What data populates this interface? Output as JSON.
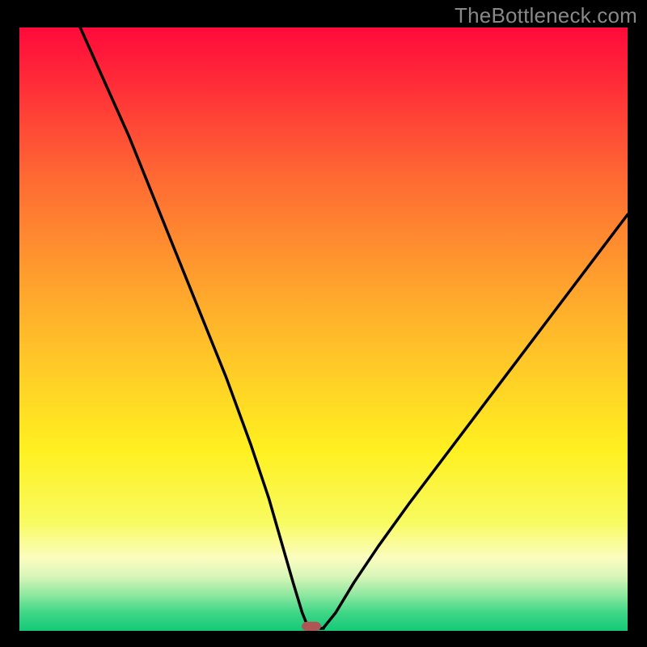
{
  "watermark": "TheBottleneck.com",
  "chart_data": {
    "type": "line",
    "title": "",
    "xlabel": "",
    "ylabel": "",
    "xlim": [
      0,
      100
    ],
    "ylim": [
      0,
      100
    ],
    "notch": {
      "x": 48,
      "width": 3.2,
      "height": 1.5
    },
    "curve_left": [
      {
        "x": 10,
        "y": 100
      },
      {
        "x": 14,
        "y": 91
      },
      {
        "x": 18,
        "y": 82
      },
      {
        "x": 22,
        "y": 72
      },
      {
        "x": 26,
        "y": 62
      },
      {
        "x": 30,
        "y": 52
      },
      {
        "x": 34,
        "y": 42
      },
      {
        "x": 38,
        "y": 31
      },
      {
        "x": 41,
        "y": 22
      },
      {
        "x": 43,
        "y": 15
      },
      {
        "x": 45,
        "y": 8
      },
      {
        "x": 46.5,
        "y": 3
      },
      {
        "x": 47.5,
        "y": 0.5
      }
    ],
    "curve_right": [
      {
        "x": 50,
        "y": 0.5
      },
      {
        "x": 52,
        "y": 3
      },
      {
        "x": 55,
        "y": 8
      },
      {
        "x": 59,
        "y": 14
      },
      {
        "x": 64,
        "y": 21
      },
      {
        "x": 70,
        "y": 29
      },
      {
        "x": 76,
        "y": 37
      },
      {
        "x": 82,
        "y": 45
      },
      {
        "x": 88,
        "y": 53
      },
      {
        "x": 94,
        "y": 61
      },
      {
        "x": 100,
        "y": 69
      }
    ],
    "gradient_stops": [
      {
        "offset": 0,
        "color": "#ff0a3a"
      },
      {
        "offset": 10,
        "color": "#ff2f38"
      },
      {
        "offset": 25,
        "color": "#ff6a33"
      },
      {
        "offset": 40,
        "color": "#ff9a2e"
      },
      {
        "offset": 55,
        "color": "#ffc728"
      },
      {
        "offset": 70,
        "color": "#fff020"
      },
      {
        "offset": 82,
        "color": "#f8fb60"
      },
      {
        "offset": 88,
        "color": "#fbfdc0"
      },
      {
        "offset": 91,
        "color": "#d8f5b8"
      },
      {
        "offset": 94,
        "color": "#8fe8a0"
      },
      {
        "offset": 97,
        "color": "#3fd687"
      },
      {
        "offset": 100,
        "color": "#14c977"
      }
    ],
    "background_color": "#000000",
    "marker_color": "#b05555",
    "curve_color": "#000000",
    "curve_width": 3.5
  }
}
